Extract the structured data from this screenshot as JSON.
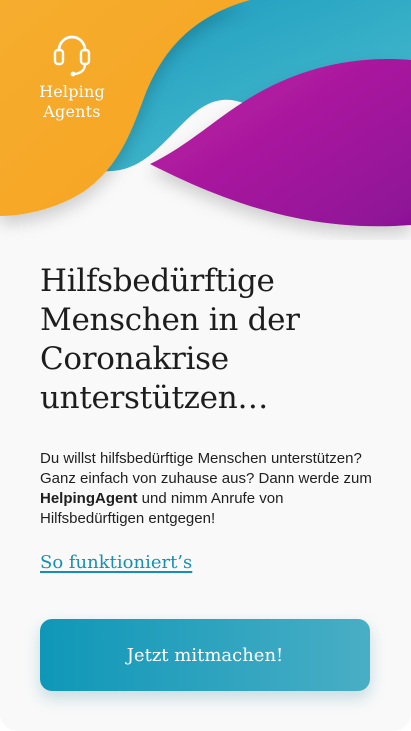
{
  "brand": {
    "line1": "Helping",
    "line2": "Agents",
    "logo_icon": "headset-icon",
    "colors": {
      "orange": "#f6ad2e",
      "blue": "#18a9c7",
      "magenta": "#b0169a",
      "text": "#1d1d1d",
      "link": "#1590b4"
    }
  },
  "content": {
    "headline": "Hilfsbedürftige Menschen in der Coronakrise unterstützen…",
    "intro_before": "Du willst hilfsbedürftige Menschen unterstützen? Ganz einfach von zuhause aus? Dann werde zum ",
    "intro_bold": "HelpingAgent",
    "intro_after": " und nimm Anrufe von Hilfsbedürftigen entgegen!",
    "how_link": "So funktioniert’s",
    "cta": "Jetzt mitmachen!"
  }
}
